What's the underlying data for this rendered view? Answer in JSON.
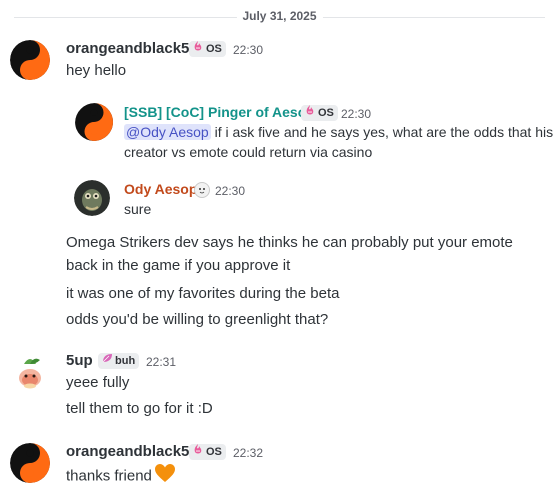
{
  "date_divider": "July 31, 2025",
  "colors": {
    "accent_teal": "#13938a",
    "ody_red": "#c24a1c",
    "mention_bg": "#dfe3fb",
    "mention_fg": "#4752c4"
  },
  "messages": [
    {
      "author": "orangeandblack5",
      "tag": "OS",
      "tag_icon": "fire-cat-icon",
      "time": "22:30",
      "lines": [
        "hey hello"
      ]
    },
    {
      "author": "[SSB] [CoC] Pinger of Aesop",
      "tag": "OS",
      "tag_icon": "fire-cat-icon",
      "time": "22:30",
      "mention": "@Ody Aesop",
      "text_line1": " if i ask five and he says yes, what are the odds that his",
      "text_line2": "creator vs emote could return via casino"
    },
    {
      "author": "Ody Aesop",
      "badge_icon": "ghost-badge-icon",
      "time": "22:30",
      "lines": [
        "sure"
      ]
    },
    {
      "lines": [
        "Omega Strikers dev says he thinks he can probably put your emote",
        "back in the game if you approve it",
        "it was one of my favorites during the beta",
        "odds you'd be willing to greenlight that?"
      ]
    },
    {
      "author": "5up",
      "tag": "buh",
      "tag_icon": "leaf-icon",
      "time": "22:31",
      "lines": [
        "yeee fully",
        "tell them to go for it :D"
      ]
    },
    {
      "author": "orangeandblack5",
      "tag": "OS",
      "tag_icon": "fire-cat-icon",
      "time": "22:32",
      "lines": [
        "thanks friend"
      ],
      "emoji": "orange-heart-icon"
    }
  ]
}
